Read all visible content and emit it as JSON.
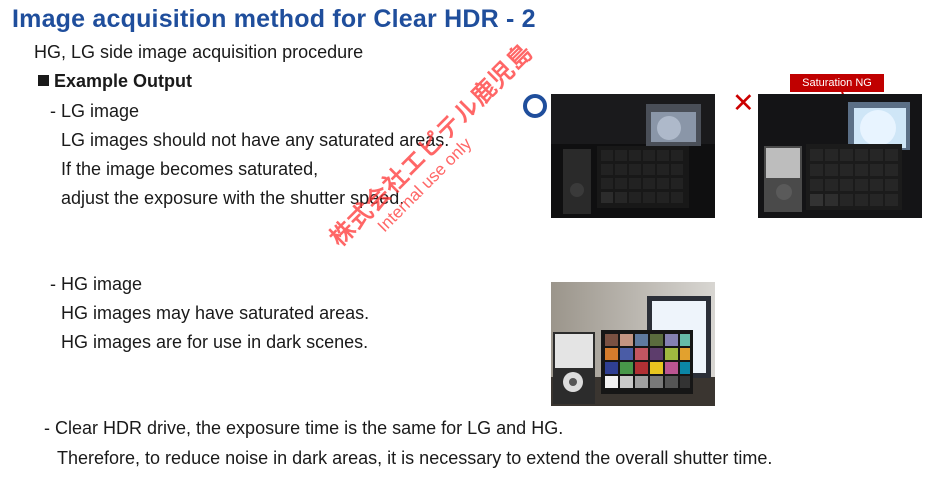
{
  "title": "Image acquisition method for Clear HDR - 2",
  "subtitle": "HG, LG side image acquisition procedure",
  "section_heading": "Example Output",
  "lg": {
    "label": "- LG image",
    "lines": [
      "LG images should not have any saturated areas.",
      "If the image becomes saturated,",
      "adjust the exposure with the shutter speed."
    ]
  },
  "hg": {
    "label": "- HG image",
    "lines": [
      "HG images may have saturated areas.",
      "HG images are for use in dark scenes."
    ]
  },
  "footer": {
    "line1": "- Clear HDR drive, the exposure time is the same for LG and HG.",
    "line2": "Therefore, to reduce noise in dark areas, it is necessary to extend the overall shutter time."
  },
  "marks": {
    "good": "circle-ok",
    "bad": "cross-ng"
  },
  "saturation_label": "Saturation NG",
  "watermark": {
    "company": "株式会社エピテル鹿児島",
    "note": "Internal use only"
  },
  "colors": {
    "title": "#1f4e9c",
    "ok_mark": "#1f4e9c",
    "ng_mark": "#cc0000",
    "ng_label_bg": "#c00000",
    "watermark": "#ff3333"
  }
}
